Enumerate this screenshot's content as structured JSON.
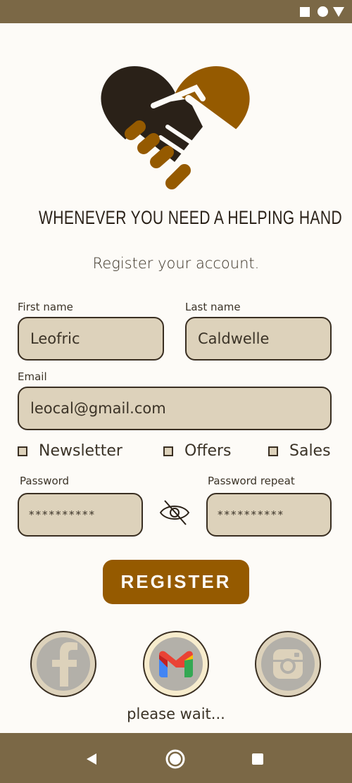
{
  "tagline": "WHENEVER YOU NEED A HELPING HAND",
  "subtitle": "Register your account.",
  "form": {
    "first_name_label": "First name",
    "first_name_value": "Leofric",
    "last_name_label": "Last name",
    "last_name_value": "Caldwelle",
    "email_label": "Email",
    "email_value": "leocal@gmail.com",
    "checkboxes": [
      {
        "label": "Newsletter",
        "checked": false
      },
      {
        "label": "Offers",
        "checked": false
      },
      {
        "label": "Sales",
        "checked": false
      }
    ],
    "password_label": "Password",
    "password_value": "**********",
    "password_repeat_label": "Password repeat",
    "password_repeat_value": "**********"
  },
  "register_label": "REGISTER",
  "social": [
    "facebook-icon",
    "gmail-icon",
    "instagram-icon"
  ],
  "status_text": "please wait...",
  "colors": {
    "bar": "#7b6846",
    "accent": "#955a00",
    "field_bg": "#ddd2bb",
    "dark": "#2a2118"
  }
}
